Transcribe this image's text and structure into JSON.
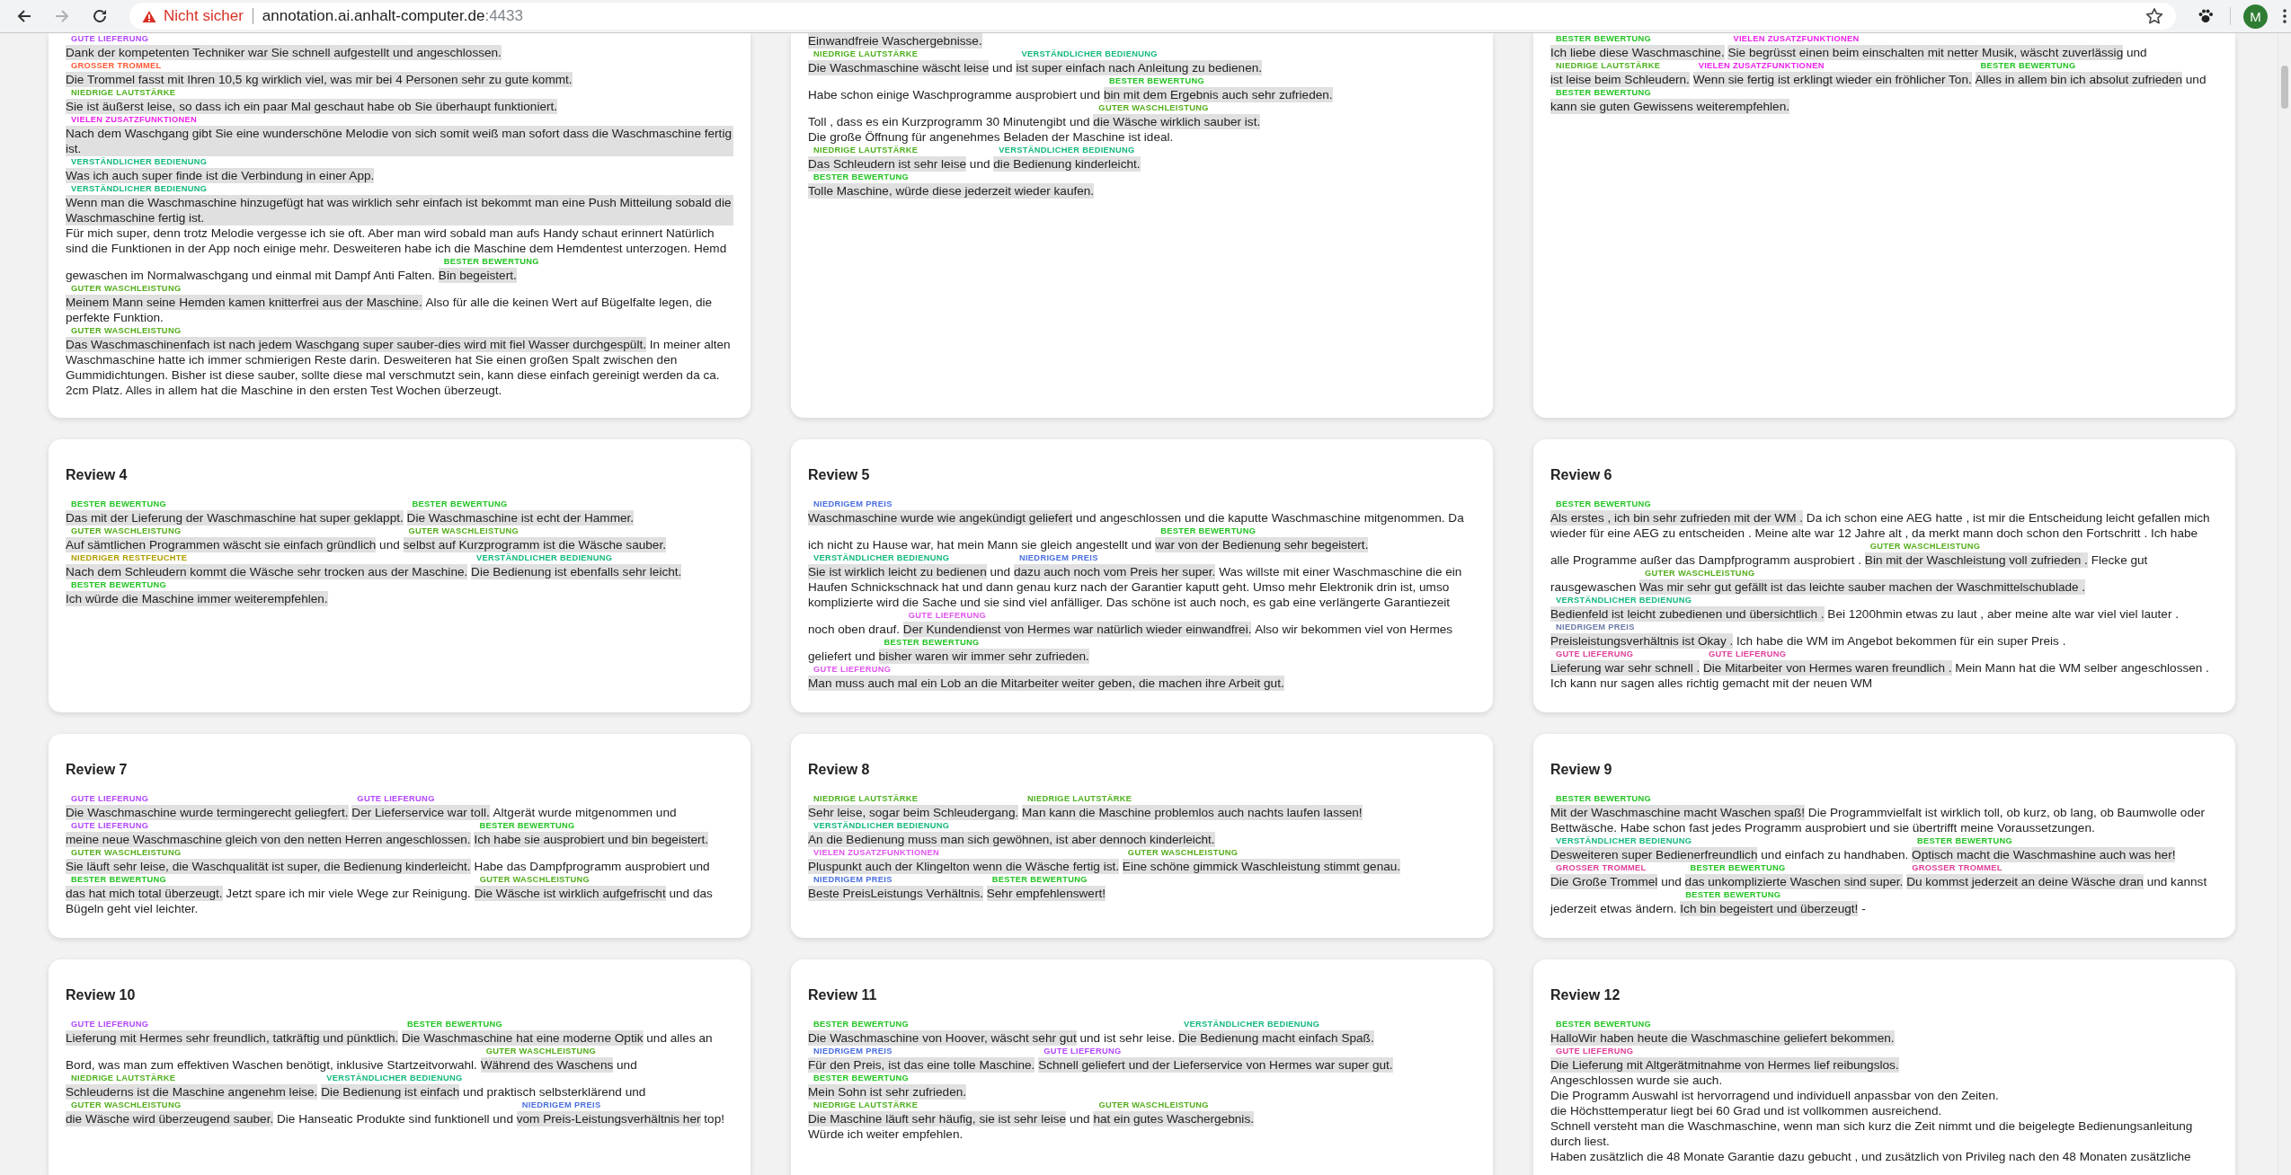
{
  "browser": {
    "back_enabled": true,
    "forward_enabled": false,
    "security_warning": "Nicht sicher",
    "url_host": "annotation.ai.anhalt-computer.de",
    "url_port": ":4433",
    "profile_initial": "M"
  },
  "cards": [
    {
      "cut": true,
      "paragraphs": [
        [
          {
            "kind": "tag",
            "label": "GUTE LIEFERUNG",
            "color": "#b347ff",
            "text": "Dank der kompetenten Techniker war Sie schnell aufgestellt und angeschlossen."
          }
        ],
        [
          {
            "kind": "tag",
            "label": "GROSSER TROMMEL",
            "color": "#ff5a36",
            "text": "Die Trommel fasst mit Ihren 10,5 kg wirklich viel, was mir bei 4 Personen sehr zu gute kommt."
          }
        ],
        [
          {
            "kind": "tag",
            "label": "NIEDRIGE LAUTSTÄRKE",
            "color": "#4fb11f",
            "text": "Sie ist äußerst leise, so dass ich ein paar Mal geschaut habe ob Sie überhaupt funktioniert."
          }
        ],
        [
          {
            "kind": "tag",
            "label": "VIELEN ZUSATZFUNKTIONEN",
            "color": "#ee22ee",
            "text": "Nach dem Waschgang gibt Sie eine wunderschöne Melodie von sich somit weiß man sofort dass die Waschmaschine fertig ist."
          }
        ],
        [
          {
            "kind": "tag",
            "label": "VERSTÄNDLICHER BEDIENUNG",
            "color": "#13b97b",
            "text": "Was ich auch super finde ist die Verbindung in einer App."
          }
        ],
        [
          {
            "kind": "tag",
            "label": "VERSTÄNDLICHER BEDIENUNG",
            "color": "#13b97b",
            "text": "Wenn man die Waschmaschine hinzugefügt hat was wirklich sehr einfach ist bekommt man eine Push Mitteilung sobald die Waschmaschine fertig ist."
          }
        ],
        [
          {
            "kind": "plain",
            "text": "Für mich super, denn trotz Melodie vergesse ich sie oft. Aber man wird sobald man aufs Handy schaut erinnert Natürlich"
          }
        ],
        [
          {
            "kind": "plain",
            "text": "sind die Funktionen in der App noch einige mehr. Desweiteren habe ich die Maschine dem Hemdentest unterzogen. Hemd"
          }
        ],
        [
          {
            "kind": "plain",
            "text": "gewaschen im Normalwaschgang und einmal mit Dampf Anti Falten."
          },
          {
            "kind": "tag",
            "label": "BESTER BEWERTUNG",
            "color": "#22c422",
            "text": "Bin begeistert."
          }
        ],
        [
          {
            "kind": "tag",
            "label": "GUTER WASCHLEISTUNG",
            "color": "#55ae1c",
            "text": "Meinem Mann seine Hemden kamen knitterfrei aus der Maschine."
          },
          {
            "kind": "plain",
            "text": "Also für alle die keinen Wert auf Bügelfalte legen, die"
          }
        ],
        [
          {
            "kind": "plain",
            "text": "perfekte Funktion."
          }
        ],
        [
          {
            "kind": "tag",
            "label": "GUTER WASCHLEISTUNG",
            "color": "#55ae1c",
            "text": "Das Waschmaschinenfach ist nach jedem Waschgang super sauber-dies wird mit fiel Wasser durchgespült."
          },
          {
            "kind": "plain",
            "text": "In meiner alten"
          }
        ],
        [
          {
            "kind": "plain",
            "text": "Waschmaschine hatte ich immer schmierigen Reste darin. Desweiteren hat Sie einen großen Spalt zwischen den"
          }
        ],
        [
          {
            "kind": "plain",
            "text": "Gummidichtungen. Bisher ist diese sauber, sollte diese mal verschmutzt sein, kann diese einfach gereinigt werden da ca."
          }
        ],
        [
          {
            "kind": "plain",
            "text": "2cm Platz. Alles in allem hat die Maschine in den ersten Test Wochen überzeugt."
          }
        ]
      ]
    },
    {
      "cut": true,
      "paragraphs": [
        [
          {
            "kind": "tag",
            "text": "Einwandfreie Waschergebnisse."
          }
        ],
        [
          {
            "kind": "tag",
            "label": "NIEDRIGE LAUTSTÄRKE",
            "color": "#4fb11f",
            "text": "Die Waschmaschine wäscht leise"
          },
          {
            "kind": "plain",
            "text": "und"
          },
          {
            "kind": "tag",
            "label": "VERSTÄNDLICHER BEDIENUNG",
            "color": "#13b97b",
            "text": "ist super einfach nach Anleitung zu bedienen."
          }
        ],
        [
          {
            "kind": "plain",
            "text": "Habe schon einige Waschprogramme ausprobiert und"
          },
          {
            "kind": "tag",
            "label": "BESTER BEWERTUNG",
            "color": "#22c422",
            "text": "bin mit dem Ergebnis auch sehr zufrieden."
          }
        ],
        [
          {
            "kind": "plain",
            "text": "Toll , dass es ein Kurzprogramm 30 Minutengibt und"
          },
          {
            "kind": "tag",
            "label": "GUTER WASCHLEISTUNG",
            "color": "#55ae1c",
            "text": "die Wäsche wirklich sauber ist."
          }
        ],
        [
          {
            "kind": "plain",
            "text": "Die große Öffnung für angenehmes Beladen der Maschine ist ideal."
          }
        ],
        [
          {
            "kind": "tag",
            "label": "NIEDRIGE LAUTSTÄRKE",
            "color": "#4fb11f",
            "text": "Das Schleudern ist sehr leise"
          },
          {
            "kind": "plain",
            "text": "und"
          },
          {
            "kind": "tag",
            "label": "VERSTÄNDLICHER BEDIENUNG",
            "color": "#13b97b",
            "text": "die Bedienung kinderleicht."
          }
        ],
        [
          {
            "kind": "tag",
            "label": "BESTER BEWERTUNG",
            "color": "#22c422",
            "text": "Tolle Maschine, würde diese jederzeit wieder kaufen."
          }
        ]
      ]
    },
    {
      "cut": true,
      "paragraphs": [
        [
          {
            "kind": "tag",
            "label": "BESTER BEWERTUNG",
            "color": "#22c422",
            "text": "Ich liebe diese Waschmaschine."
          },
          {
            "kind": "tag",
            "label": "VIELEN ZUSATZFUNKTIONEN",
            "color": "#ee22ee",
            "text": "Sie begrüsst einen beim einschalten mit netter Musik, wäscht zuverlässig"
          },
          {
            "kind": "plain",
            "text": "und"
          }
        ],
        [
          {
            "kind": "tag",
            "label": "NIEDRIGE LAUTSTÄRKE",
            "color": "#4fb11f",
            "text": "ist leise beim Schleudern."
          },
          {
            "kind": "tag",
            "label": "VIELEN ZUSATZFUNKTIONEN",
            "color": "#ee22ee",
            "text": "Wenn sie fertig ist erklingt wieder ein fröhlicher Ton."
          },
          {
            "kind": "tag",
            "label": "BESTER BEWERTUNG",
            "color": "#22c422",
            "text": "Alles in allem bin ich absolut zufrieden"
          },
          {
            "kind": "plain",
            "text": "und"
          }
        ],
        [
          {
            "kind": "tag",
            "label": "BESTER BEWERTUNG",
            "color": "#22c422",
            "text": "kann sie guten Gewissens weiterempfehlen."
          }
        ]
      ]
    },
    {
      "title": "Review 4",
      "paragraphs": [
        [
          {
            "kind": "tag",
            "label": "BESTER BEWERTUNG",
            "color": "#22c422",
            "text": "Das mit der Lieferung der Waschmaschine hat super geklappt."
          },
          {
            "kind": "tag",
            "label": "BESTER BEWERTUNG",
            "color": "#22c422",
            "text": "Die Waschmaschine ist echt der Hammer."
          }
        ],
        [
          {
            "kind": "tag",
            "label": "GUTER WASCHLEISTUNG",
            "color": "#55ae1c",
            "text": "Auf sämtlichen Programmen wäscht sie einfach gründlich"
          },
          {
            "kind": "plain",
            "text": "und"
          },
          {
            "kind": "tag",
            "label": "GUTER WASCHLEISTUNG",
            "color": "#55ae1c",
            "text": "selbst auf Kurzprogramm ist die Wäsche sauber."
          }
        ],
        [
          {
            "kind": "tag",
            "label": "NIEDRIGER RESTFEUCHTE",
            "color": "#b09e00",
            "text": "Nach dem Schleudern kommt die Wäsche sehr trocken aus der Maschine."
          },
          {
            "kind": "tag",
            "label": "VERSTÄNDLICHER BEDIENUNG",
            "color": "#13b97b",
            "text": "Die Bedienung ist ebenfalls sehr leicht."
          }
        ],
        [
          {
            "kind": "tag",
            "label": "BESTER BEWERTUNG",
            "color": "#22c422",
            "text": "Ich würde die Maschine immer weiterempfehlen."
          }
        ]
      ]
    },
    {
      "title": "Review 5",
      "paragraphs": [
        [
          {
            "kind": "tag",
            "label": "NIEDRIGEM PREIS",
            "color": "#4a6fe0",
            "text": "Waschmaschine wurde wie angekündigt geliefert"
          },
          {
            "kind": "plain",
            "text": "und angeschlossen und die kaputte Waschmaschine mitgenommen. Da"
          }
        ],
        [
          {
            "kind": "plain",
            "text": "ich nicht zu Hause war, hat mein Mann sie gleich angestellt und"
          },
          {
            "kind": "tag",
            "label": "BESTER BEWERTUNG",
            "color": "#22c422",
            "text": "war von der Bedienung sehr begeistert."
          }
        ],
        [
          {
            "kind": "tag",
            "label": "VERSTÄNDLICHER BEDIENUNG",
            "color": "#13b97b",
            "text": "Sie ist wirklich leicht zu bedienen"
          },
          {
            "kind": "plain",
            "text": "und"
          },
          {
            "kind": "tag",
            "label": "NIEDRIGEM PREIS",
            "color": "#4a6fe0",
            "text": "dazu auch noch vom Preis her super."
          },
          {
            "kind": "plain",
            "text": "Was willste mit einer Waschmaschine die ein"
          }
        ],
        [
          {
            "kind": "plain",
            "text": "Haufen Schnickschnack hat und dann genau kurz nach der Garantier kaputt geht. Umso mehr Elektronik drin ist, umso"
          }
        ],
        [
          {
            "kind": "plain",
            "text": "komplizierte wird die Sache und sie sind viel anfälliger. Das schöne ist auch noch, es gab eine verlängerte Garantiezeit"
          }
        ],
        [
          {
            "kind": "plain",
            "text": "noch oben drauf."
          },
          {
            "kind": "tag",
            "label": "GUTE LIEFERUNG",
            "color": "#e055ee",
            "text": "Der Kundendienst von Hermes war natürlich wieder einwandfrei."
          },
          {
            "kind": "plain",
            "text": "Also wir bekommen viel von Hermes"
          }
        ],
        [
          {
            "kind": "plain",
            "text": "geliefert und"
          },
          {
            "kind": "tag",
            "label": "BESTER BEWERTUNG",
            "color": "#22c422",
            "text": "bisher waren wir immer sehr zufrieden."
          }
        ],
        [
          {
            "kind": "tag",
            "label": "GUTE LIEFERUNG",
            "color": "#e055ee",
            "text": "Man muss auch mal ein Lob an die Mitarbeiter weiter geben, die machen ihre Arbeit gut."
          }
        ]
      ]
    },
    {
      "title": "Review 6",
      "paragraphs": [
        [
          {
            "kind": "tag",
            "label": "BESTER BEWERTUNG",
            "color": "#22c422",
            "text": "Als erstes , ich bin sehr zufrieden mit der WM ."
          },
          {
            "kind": "plain",
            "text": "Da ich schon eine AEG hatte , ist mir die Entscheidung leicht gefallen mich"
          }
        ],
        [
          {
            "kind": "plain",
            "text": "wieder für eine AEG zu entscheiden . Meine alte war 12 Jahre alt , da merkt mann doch schon den Fortschritt . Ich habe"
          }
        ],
        [
          {
            "kind": "plain",
            "text": "alle Programme außer das Dampfprogramm ausprobiert ."
          },
          {
            "kind": "tag",
            "label": "GUTER WASCHLEISTUNG",
            "color": "#55ae1c",
            "text": "Bin mit der Waschleistung voll zufrieden ."
          },
          {
            "kind": "plain",
            "text": "Flecke gut"
          }
        ],
        [
          {
            "kind": "plain",
            "text": "rausgewaschen"
          },
          {
            "kind": "tag",
            "label": "GUTER WASCHLEISTUNG",
            "color": "#55ae1c",
            "text": "Was mir sehr gut gefällt ist das leichte sauber machen der Waschmittelschublade ."
          }
        ],
        [
          {
            "kind": "tag",
            "label": "VERSTÄNDLICHER BEDIENUNG",
            "color": "#13b97b",
            "text": "Bedienfeld ist leicht zubedienen und übersichtlich ."
          },
          {
            "kind": "plain",
            "text": "Bei 1200hmin etwas zu laut , aber meine alte war viel viel lauter ."
          }
        ],
        [
          {
            "kind": "tag",
            "label": "NIEDRIGEM PREIS",
            "color": "#6a7aa8",
            "text": "Preisleistungsverhältnis ist Okay ."
          },
          {
            "kind": "plain",
            "text": "Ich habe die WM im Angebot bekommen für ein super Preis ."
          }
        ],
        [
          {
            "kind": "tag",
            "label": "GUTE LIEFERUNG",
            "color": "#e0409a",
            "text": "Lieferung war sehr schnell ."
          },
          {
            "kind": "tag",
            "label": "GUTE LIEFERUNG",
            "color": "#e0409a",
            "text": "Die Mitarbeiter von Hermes waren freundlich ."
          },
          {
            "kind": "plain",
            "text": "Mein Mann hat die WM selber angeschlossen ."
          }
        ],
        [
          {
            "kind": "plain",
            "text": "Ich kann nur sagen alles richtig gemacht mit der neuen WM"
          }
        ]
      ]
    },
    {
      "title": "Review 7",
      "paragraphs": [
        [
          {
            "kind": "tag",
            "label": "GUTE LIEFERUNG",
            "color": "#b347ff",
            "text": "Die Waschmaschine wurde termingerecht geliegfert."
          },
          {
            "kind": "tag",
            "label": "GUTE LIEFERUNG",
            "color": "#b347ff",
            "text": "Der Lieferservice war toll."
          },
          {
            "kind": "plain",
            "text": "Altgerät wurde mitgenommen und"
          }
        ],
        [
          {
            "kind": "tag",
            "label": "GUTE LIEFERUNG",
            "color": "#b347ff",
            "text": "meine neue Waschmaschine gleich von den netten Herren angeschlossen."
          },
          {
            "kind": "tag",
            "label": "BESTER BEWERTUNG",
            "color": "#22c422",
            "text": "Ich habe sie ausprobiert und bin begeistert."
          }
        ],
        [
          {
            "kind": "tag",
            "label": "GUTER WASCHLEISTUNG",
            "color": "#55ae1c",
            "text": "Sie läuft sehr leise, die Waschqualität ist super, die Bedienung kinderleicht."
          },
          {
            "kind": "plain",
            "text": "Habe das Dampfprogramm ausprobiert und"
          }
        ],
        [
          {
            "kind": "tag",
            "label": "BESTER BEWERTUNG",
            "color": "#22c422",
            "text": "das hat mich total überzeugt."
          },
          {
            "kind": "plain",
            "text": "Jetzt spare ich mir viele Wege zur Reinigung."
          },
          {
            "kind": "tag",
            "label": "GUTER WASCHLEISTUNG",
            "color": "#55ae1c",
            "text": "Die Wäsche ist wirklich aufgefrischt"
          },
          {
            "kind": "plain",
            "text": "und das"
          }
        ],
        [
          {
            "kind": "plain",
            "text": "Bügeln geht viel leichter."
          }
        ]
      ]
    },
    {
      "title": "Review 8",
      "paragraphs": [
        [
          {
            "kind": "tag",
            "label": "NIEDRIGE LAUTSTÄRKE",
            "color": "#4fb11f",
            "text": "Sehr leise, sogar beim Schleudergang."
          },
          {
            "kind": "tag",
            "label": "NIEDRIGE LAUTSTÄRKE",
            "color": "#4fb11f",
            "text": "Man kann die Maschine problemlos auch nachts laufen lassen!"
          }
        ],
        [
          {
            "kind": "tag",
            "label": "VERSTÄNDLICHER BEDIENUNG",
            "color": "#13b97b",
            "text": "An die Bedienung muss man sich gewöhnen, ist aber dennoch kinderleicht."
          }
        ],
        [
          {
            "kind": "tag",
            "label": "VIELEN ZUSATZFUNKTIONEN",
            "color": "#e055ee",
            "text": "Pluspunkt auch der Klingelton wenn die Wäsche fertig ist."
          },
          {
            "kind": "tag",
            "label": "GUTER WASCHLEISTUNG",
            "color": "#55ae1c",
            "text": "Eine schöne gimmick Waschleistung stimmt genau."
          }
        ],
        [
          {
            "kind": "tag",
            "label": "NIEDRIGEM PREIS",
            "color": "#4a6fe0",
            "text": "Beste PreisLeistungs Verhältnis."
          },
          {
            "kind": "tag",
            "label": "BESTER BEWERTUNG",
            "color": "#22c422",
            "text": "Sehr empfehlenswert!"
          }
        ]
      ]
    },
    {
      "title": "Review 9",
      "paragraphs": [
        [
          {
            "kind": "tag",
            "label": "BESTER BEWERTUNG",
            "color": "#22c422",
            "text": "Mit der Waschmaschine macht Waschen spaß!"
          },
          {
            "kind": "plain",
            "text": "Die Programmvielfalt ist wirklich toll, ob kurz, ob lang, ob Baumwolle oder"
          }
        ],
        [
          {
            "kind": "plain",
            "text": "Bettwäsche. Habe schon fast jedes Programm ausprobiert und sie übertrifft meine Voraussetzungen."
          }
        ],
        [
          {
            "kind": "tag",
            "label": "VERSTÄNDLICHER BEDIENUNG",
            "color": "#13b97b",
            "text": "Desweiteren super Bedienerfreundlich"
          },
          {
            "kind": "plain",
            "text": "und einfach zu handhaben."
          },
          {
            "kind": "tag",
            "label": "BESTER BEWERTUNG",
            "color": "#22c422",
            "text": "Optisch macht die Waschmashine auch was her!"
          }
        ],
        [
          {
            "kind": "tag",
            "label": "GROSSER TROMMEL",
            "color": "#e0409a",
            "text": "Die Große Trommel"
          },
          {
            "kind": "plain",
            "text": "und"
          },
          {
            "kind": "tag",
            "label": "BESTER BEWERTUNG",
            "color": "#22c422",
            "text": "das unkomplizierte Waschen sind super."
          },
          {
            "kind": "tag",
            "label": "GROSSER TROMMEL",
            "color": "#e0409a",
            "text": "Du kommst jederzeit an deine Wäsche dran"
          },
          {
            "kind": "plain",
            "text": "und kannst"
          }
        ],
        [
          {
            "kind": "plain",
            "text": "jederzeit etwas ändern."
          },
          {
            "kind": "tag",
            "label": "BESTER BEWERTUNG",
            "color": "#22c422",
            "text": "Ich bin begeistert und überzeugt!"
          },
          {
            "kind": "plain",
            "text": "-"
          }
        ]
      ]
    },
    {
      "title": "Review 10",
      "paragraphs": [
        [
          {
            "kind": "tag",
            "label": "GUTE LIEFERUNG",
            "color": "#b347ff",
            "text": "Lieferung mit Hermes sehr freundlich, tatkräftig und pünktlich."
          },
          {
            "kind": "tag",
            "label": "BESTER BEWERTUNG",
            "color": "#22c422",
            "text": "Die Waschmaschine hat eine moderne Optik"
          },
          {
            "kind": "plain",
            "text": "und alles an"
          }
        ],
        [
          {
            "kind": "plain",
            "text": "Bord, was man zum effektiven Waschen benötigt, inklusive Startzeitvorwahl."
          },
          {
            "kind": "tag",
            "label": "GUTER WASCHLEISTUNG",
            "color": "#55ae1c",
            "text": "Während des Waschens"
          },
          {
            "kind": "plain",
            "text": "und"
          }
        ],
        [
          {
            "kind": "tag",
            "label": "NIEDRIGE LAUTSTÄRKE",
            "color": "#4fb11f",
            "text": "Schleuderns ist die Maschine angenehm leise."
          },
          {
            "kind": "tag",
            "label": "VERSTÄNDLICHER BEDIENUNG",
            "color": "#13b97b",
            "text": "Die Bedienung ist einfach"
          },
          {
            "kind": "plain",
            "text": "und praktisch selbsterklärend und"
          }
        ],
        [
          {
            "kind": "tag",
            "label": "GUTER WASCHLEISTUNG",
            "color": "#55ae1c",
            "text": "die Wäsche wird überzeugend sauber."
          },
          {
            "kind": "plain",
            "text": "Die Hanseatic Produkte sind funktionell und"
          },
          {
            "kind": "tag",
            "label": "NIEDRIGEM PREIS",
            "color": "#4a6fe0",
            "text": "vom Preis-Leistungsverhältnis her"
          },
          {
            "kind": "plain",
            "text": "top!"
          }
        ]
      ]
    },
    {
      "title": "Review 11",
      "paragraphs": [
        [
          {
            "kind": "tag",
            "label": "BESTER BEWERTUNG",
            "color": "#22c422",
            "text": "Die Waschmaschine von Hoover, wäscht sehr gut"
          },
          {
            "kind": "plain",
            "text": "und ist sehr leise."
          },
          {
            "kind": "tag",
            "label": "VERSTÄNDLICHER BEDIENUNG",
            "color": "#13b97b",
            "text": "Die Bedienung macht einfach Spaß."
          }
        ],
        [
          {
            "kind": "tag",
            "label": "NIEDRIGEM PREIS",
            "color": "#4a6fe0",
            "text": "Für den Preis, ist das eine tolle Maschine."
          },
          {
            "kind": "tag",
            "label": "GUTE LIEFERUNG",
            "color": "#b347ff",
            "text": "Schnell geliefert und der Lieferservice von Hermes war super gut."
          }
        ],
        [
          {
            "kind": "tag",
            "label": "BESTER BEWERTUNG",
            "color": "#22c422",
            "text": "Mein Sohn ist sehr zufrieden."
          }
        ],
        [
          {
            "kind": "tag",
            "label": "NIEDRIGE LAUTSTÄRKE",
            "color": "#4fb11f",
            "text": "Die Maschine läuft sehr häufig, sie ist sehr leise"
          },
          {
            "kind": "plain",
            "text": "und"
          },
          {
            "kind": "tag",
            "label": "GUTER WASCHLEISTUNG",
            "color": "#55ae1c",
            "text": "hat ein gutes Waschergebnis."
          }
        ],
        [
          {
            "kind": "plain",
            "text": "Würde ich weiter empfehlen."
          }
        ]
      ]
    },
    {
      "title": "Review 12",
      "paragraphs": [
        [
          {
            "kind": "tag",
            "label": "BESTER BEWERTUNG",
            "color": "#22c422",
            "text": "HalloWir haben heute die Waschmaschine geliefert bekommen."
          }
        ],
        [
          {
            "kind": "tag",
            "label": "GUTE LIEFERUNG",
            "color": "#e0409a",
            "text": "Die Lieferung mit Altgerätmitnahme von Hermes lief reibungslos."
          }
        ],
        [
          {
            "kind": "plain",
            "text": "Angeschlossen wurde sie auch."
          }
        ],
        [
          {
            "kind": "plain",
            "text": "Die Programm Auswahl ist hervorragend und individuell anpassbar von den Zeiten."
          }
        ],
        [
          {
            "kind": "plain",
            "text": "die Höchsttemperatur liegt bei 60 Grad und ist vollkommen ausreichend."
          }
        ],
        [
          {
            "kind": "plain",
            "text": "Schnell versteht man die Waschmaschine, wenn man sich kurz die Zeit nimmt und die beigelegte Bedienungsanleitung"
          }
        ],
        [
          {
            "kind": "plain",
            "text": "durch liest."
          }
        ],
        [
          {
            "kind": "plain",
            "text": "Haben zusätzlich die 48 Monate Garantie dazu gebucht , und zusätzlich von Privileg nach den 48 Monaten zusätzliche"
          }
        ]
      ]
    }
  ]
}
